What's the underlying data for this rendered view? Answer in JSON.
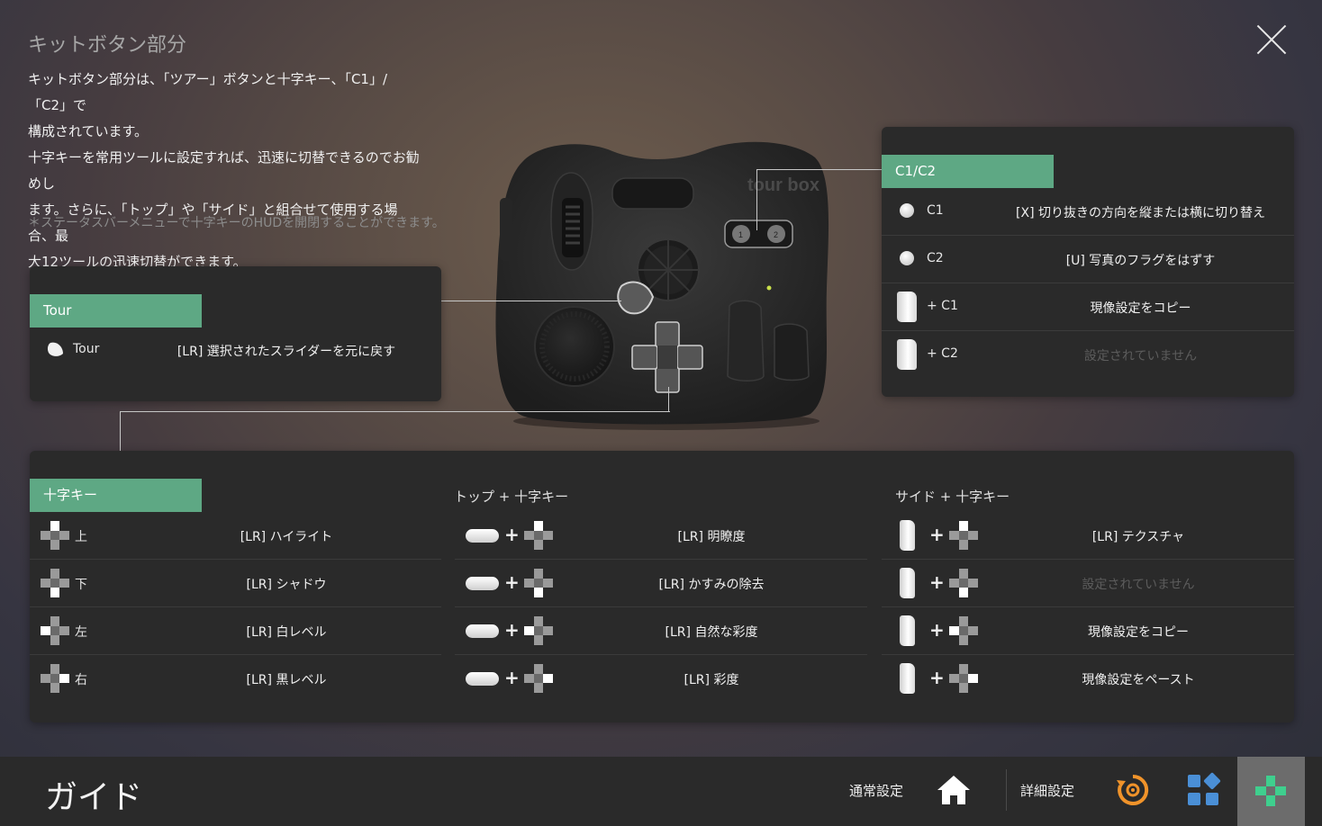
{
  "page": {
    "title": "キットボタン部分",
    "intro_lines": [
      "キットボタン部分は、「ツアー」ボタンと十字キー、「C1」/「C2」で",
      "構成されています。",
      "十字キーを常用ツールに設定すれば、迅速に切替できるのでお勧めし",
      "ます。さらに、「トップ」や「サイド」と組合せて使用する場合、最",
      "大12ツールの迅速切替ができます。"
    ],
    "note": "＊ステータスバーメニューで十字キーのHUDを開閉することができます。"
  },
  "tour_panel": {
    "tag": "Tour",
    "row": {
      "label": "Tour",
      "value": "[LR] 選択されたスライダーを元に戻す"
    }
  },
  "c_panel": {
    "tag": "C1/C2",
    "rows": [
      {
        "label": "C1",
        "value": "[X] 切り抜きの方向を縦または横に切り替え",
        "icon": "dot",
        "dim": false
      },
      {
        "label": "C2",
        "value": "[U] 写真のフラグをはずす",
        "icon": "dot",
        "dim": false
      },
      {
        "label": "+ C1",
        "value": "現像設定をコピー",
        "icon": "side-key",
        "dim": false
      },
      {
        "label": "+ C2",
        "value": "設定されていません",
        "icon": "side-key",
        "dim": true
      }
    ]
  },
  "dpad_panel": {
    "tag": "十字キー",
    "col2_title": "トップ + 十字キー",
    "col3_title": "サイド + 十字キー",
    "col1": [
      {
        "label": "上",
        "value": "[LR] ハイライト",
        "dir": "up"
      },
      {
        "label": "下",
        "value": "[LR] シャドウ",
        "dir": "down"
      },
      {
        "label": "左",
        "value": "[LR] 白レベル",
        "dir": "left"
      },
      {
        "label": "右",
        "value": "[LR] 黒レベル",
        "dir": "right"
      }
    ],
    "col2": [
      {
        "value": "[LR] 明瞭度",
        "dir": "up"
      },
      {
        "value": "[LR] かすみの除去",
        "dir": "down"
      },
      {
        "value": "[LR] 自然な彩度",
        "dir": "left"
      },
      {
        "value": "[LR] 彩度",
        "dir": "right"
      }
    ],
    "col3": [
      {
        "value": "[LR] テクスチャ",
        "dir": "up",
        "dim": false
      },
      {
        "value": "設定されていません",
        "dir": "down",
        "dim": true
      },
      {
        "value": "現像設定をコピー",
        "dir": "left",
        "dim": false
      },
      {
        "value": "現像設定をペースト",
        "dir": "right",
        "dim": false
      }
    ]
  },
  "device": {
    "logo_text": "tour box",
    "c1_label": "1",
    "c2_label": "2"
  },
  "bottom_bar": {
    "title": "ガイド",
    "nav_general": "通常設定",
    "nav_advanced": "詳細設定",
    "icons": [
      "home-icon",
      "refresh-target-icon",
      "apps-grid-icon",
      "dpad-icon"
    ]
  },
  "colors": {
    "accent_green": "#5ea884",
    "panel_bg": "#2a2a2a",
    "orange_icon": "#f0932a",
    "blue_icon": "#4a8fd6",
    "green_icon": "#3fcf8e"
  }
}
